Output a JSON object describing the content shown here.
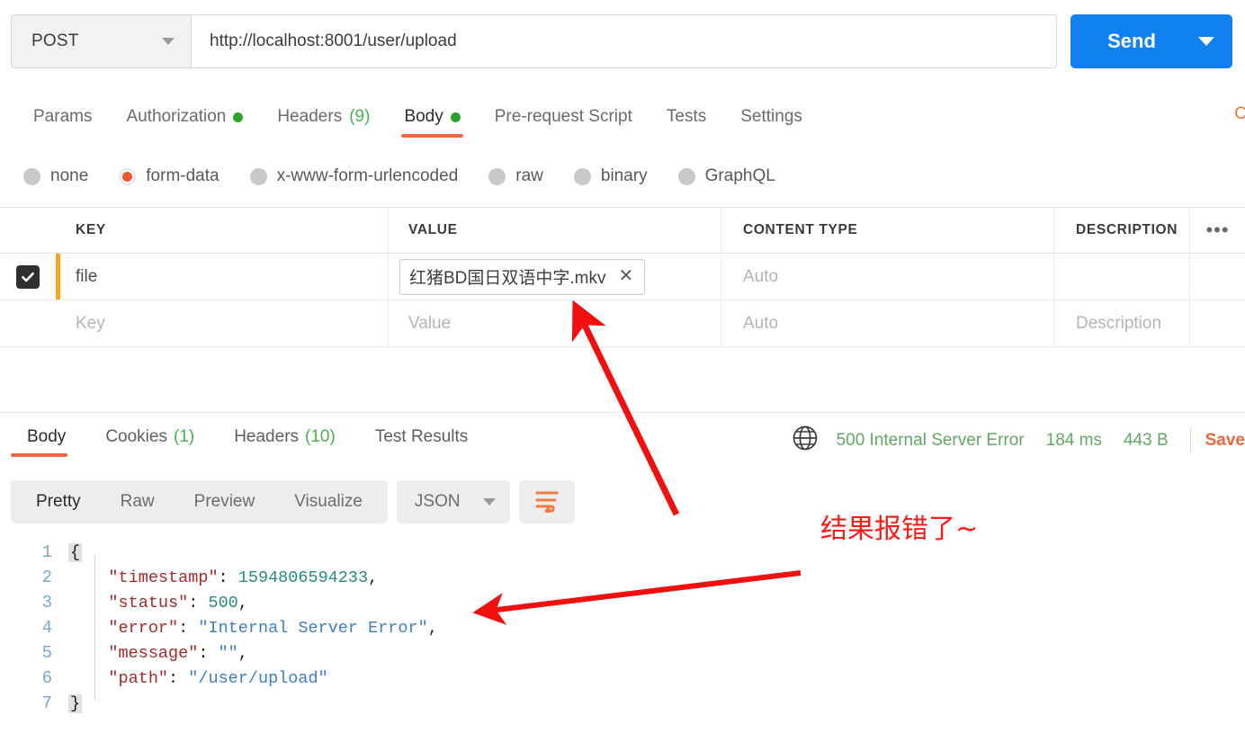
{
  "request": {
    "method": "POST",
    "url": "http://localhost:8001/user/upload",
    "send_label": "Send",
    "tabs": [
      {
        "label": "Params",
        "badge": "",
        "badge_type": "none",
        "active": false
      },
      {
        "label": "Authorization",
        "badge": "",
        "badge_type": "dot",
        "active": false
      },
      {
        "label": "Headers",
        "badge": "(9)",
        "badge_type": "count",
        "active": false
      },
      {
        "label": "Body",
        "badge": "",
        "badge_type": "dot",
        "active": true
      },
      {
        "label": "Pre-request Script",
        "badge": "",
        "badge_type": "none",
        "active": false
      },
      {
        "label": "Tests",
        "badge": "",
        "badge_type": "none",
        "active": false
      },
      {
        "label": "Settings",
        "badge": "",
        "badge_type": "none",
        "active": false
      }
    ],
    "cookies_link": "C",
    "body_types": [
      {
        "label": "none",
        "selected": false
      },
      {
        "label": "form-data",
        "selected": true
      },
      {
        "label": "x-www-form-urlencoded",
        "selected": false
      },
      {
        "label": "raw",
        "selected": false
      },
      {
        "label": "binary",
        "selected": false
      },
      {
        "label": "GraphQL",
        "selected": false
      }
    ],
    "table": {
      "headers": {
        "key": "KEY",
        "value": "VALUE",
        "content_type": "CONTENT TYPE",
        "description": "DESCRIPTION",
        "more": "•••"
      },
      "rows": [
        {
          "checked": true,
          "key": "file",
          "value_chip": "红猪BD国日双语中字.mkv",
          "chip_close": "✕",
          "content_type": "Auto",
          "description": "",
          "is_placeholder_row": false
        },
        {
          "checked": false,
          "key": "Key",
          "value_chip": "Value",
          "chip_close": "",
          "content_type": "Auto",
          "description": "Description",
          "is_placeholder_row": true
        }
      ]
    }
  },
  "response": {
    "tabs": [
      {
        "label": "Body",
        "badge": "",
        "active": true
      },
      {
        "label": "Cookies",
        "badge": "(1)",
        "active": false
      },
      {
        "label": "Headers",
        "badge": "(10)",
        "active": false
      },
      {
        "label": "Test Results",
        "badge": "",
        "active": false
      }
    ],
    "meta": {
      "status": "500 Internal Server Error",
      "time": "184 ms",
      "size": "443 B",
      "save_label": "Save"
    },
    "view_modes": [
      {
        "label": "Pretty",
        "active": true
      },
      {
        "label": "Raw",
        "active": false
      },
      {
        "label": "Preview",
        "active": false
      },
      {
        "label": "Visualize",
        "active": false
      }
    ],
    "format_selected": "JSON",
    "body_lines": [
      {
        "no": "1",
        "indent": 0,
        "tokens": [
          {
            "t": "{",
            "c": "brace"
          }
        ]
      },
      {
        "no": "2",
        "indent": 1,
        "tokens": [
          {
            "t": "\"timestamp\"",
            "c": "key"
          },
          {
            "t": ": ",
            "c": "punct"
          },
          {
            "t": "1594806594233",
            "c": "num"
          },
          {
            "t": ",",
            "c": "punct"
          }
        ]
      },
      {
        "no": "3",
        "indent": 1,
        "tokens": [
          {
            "t": "\"status\"",
            "c": "key"
          },
          {
            "t": ": ",
            "c": "punct"
          },
          {
            "t": "500",
            "c": "num"
          },
          {
            "t": ",",
            "c": "punct"
          }
        ]
      },
      {
        "no": "4",
        "indent": 1,
        "tokens": [
          {
            "t": "\"error\"",
            "c": "key"
          },
          {
            "t": ": ",
            "c": "punct"
          },
          {
            "t": "\"Internal Server Error\"",
            "c": "str"
          },
          {
            "t": ",",
            "c": "punct"
          }
        ]
      },
      {
        "no": "5",
        "indent": 1,
        "tokens": [
          {
            "t": "\"message\"",
            "c": "key"
          },
          {
            "t": ": ",
            "c": "punct"
          },
          {
            "t": "\"\"",
            "c": "str"
          },
          {
            "t": ",",
            "c": "punct"
          }
        ]
      },
      {
        "no": "6",
        "indent": 1,
        "tokens": [
          {
            "t": "\"path\"",
            "c": "key"
          },
          {
            "t": ": ",
            "c": "punct"
          },
          {
            "t": "\"/user/upload\"",
            "c": "str"
          }
        ]
      },
      {
        "no": "7",
        "indent": 0,
        "tokens": [
          {
            "t": "}",
            "c": "brace"
          }
        ]
      }
    ]
  },
  "annotations": {
    "note_text": "结果报错了~",
    "note_color": "#ff1a1a",
    "arrow_color": "#f01010"
  },
  "colors": {
    "accent_orange": "#f0673b",
    "send_blue": "#1181f0",
    "status_green": "#62a866",
    "row_accent": "#f5a623",
    "checkbox_dark": "#2f2f2f"
  }
}
